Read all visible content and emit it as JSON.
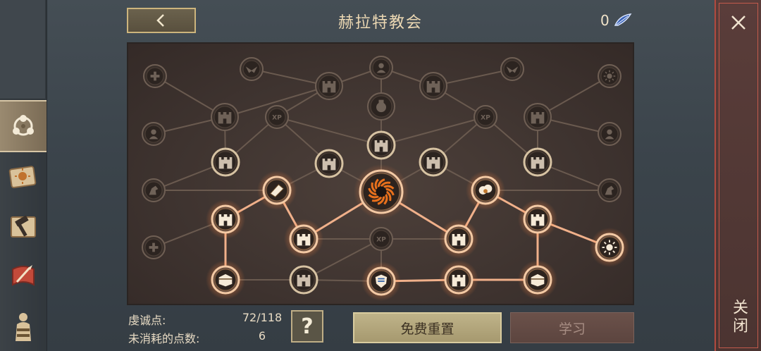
{
  "title": "赫拉特教会",
  "currency": {
    "amount": "0",
    "icon": "feather-gem-icon"
  },
  "close": {
    "label": "关闭"
  },
  "stats": {
    "piety_label": "虔诚点:",
    "piety_value": "72/118",
    "unspent_label": "未消耗的点数:",
    "unspent_value": "6"
  },
  "help": {
    "label": "?"
  },
  "buttons": {
    "reset": "免费重置",
    "learn": "学习"
  },
  "sidebar": [
    {
      "name": "sidebar-tab-network",
      "icon": "network-nodes-icon",
      "active": true
    },
    {
      "name": "sidebar-tab-scroll",
      "icon": "sun-scroll-icon",
      "active": false
    },
    {
      "name": "sidebar-tab-hammer",
      "icon": "hammer-map-icon",
      "active": false
    },
    {
      "name": "sidebar-tab-quill",
      "icon": "quill-scroll-icon",
      "active": false
    },
    {
      "name": "sidebar-tab-hero",
      "icon": "hero-figure-icon",
      "active": false
    }
  ],
  "tree": {
    "nodes": [
      {
        "id": "n1",
        "icon": "plus",
        "state": "locked"
      },
      {
        "id": "n2",
        "icon": "eagle",
        "state": "locked"
      },
      {
        "id": "n3",
        "icon": "tower",
        "state": "locked"
      },
      {
        "id": "n4",
        "icon": "soldier",
        "state": "locked"
      },
      {
        "id": "n5",
        "icon": "tower",
        "state": "locked"
      },
      {
        "id": "n6",
        "icon": "eagle",
        "state": "locked"
      },
      {
        "id": "n7",
        "icon": "sun",
        "state": "locked"
      },
      {
        "id": "n8",
        "icon": "tower",
        "state": "locked"
      },
      {
        "id": "n9",
        "icon": "xp",
        "state": "locked"
      },
      {
        "id": "n10",
        "icon": "pot",
        "state": "locked"
      },
      {
        "id": "n11",
        "icon": "xp",
        "state": "locked"
      },
      {
        "id": "n12",
        "icon": "tower",
        "state": "locked"
      },
      {
        "id": "n13",
        "icon": "soldier",
        "state": "locked"
      },
      {
        "id": "n14",
        "icon": "soldier",
        "state": "locked"
      },
      {
        "id": "n15",
        "icon": "tower",
        "state": "available"
      },
      {
        "id": "n16",
        "icon": "tower",
        "state": "available"
      },
      {
        "id": "n17",
        "icon": "tower",
        "state": "available"
      },
      {
        "id": "n18",
        "icon": "tower",
        "state": "available"
      },
      {
        "id": "n19",
        "icon": "tower",
        "state": "available"
      },
      {
        "id": "n20",
        "icon": "horse",
        "state": "locked"
      },
      {
        "id": "n21",
        "icon": "bag",
        "state": "learned"
      },
      {
        "id": "n22",
        "icon": "vortex",
        "state": "learned"
      },
      {
        "id": "n23",
        "icon": "cloud",
        "state": "learned"
      },
      {
        "id": "n24",
        "icon": "horse",
        "state": "locked"
      },
      {
        "id": "n25",
        "icon": "tower",
        "state": "learned"
      },
      {
        "id": "n26",
        "icon": "tower",
        "state": "learned"
      },
      {
        "id": "n27",
        "icon": "tower",
        "state": "learned"
      },
      {
        "id": "n28",
        "icon": "tower",
        "state": "learned"
      },
      {
        "id": "n29",
        "icon": "plus",
        "state": "locked"
      },
      {
        "id": "n30",
        "icon": "xp",
        "state": "locked"
      },
      {
        "id": "n31",
        "icon": "sun",
        "state": "learned"
      },
      {
        "id": "n32",
        "icon": "chest",
        "state": "learned"
      },
      {
        "id": "n33",
        "icon": "tower",
        "state": "available"
      },
      {
        "id": "n34",
        "icon": "shield",
        "state": "learned"
      },
      {
        "id": "n35",
        "icon": "tower",
        "state": "learned"
      },
      {
        "id": "n36",
        "icon": "chest",
        "state": "learned"
      }
    ]
  }
}
